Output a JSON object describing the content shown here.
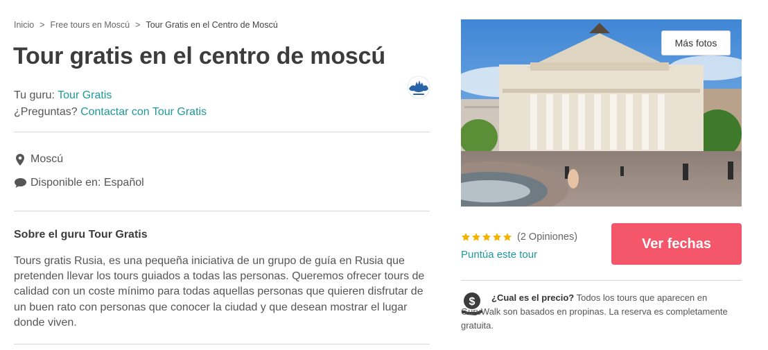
{
  "breadcrumb": {
    "items": [
      "Inicio",
      "Free tours en Moscú",
      "Tour Gratis en el Centro de Moscú"
    ],
    "separator": ">"
  },
  "tour": {
    "title": "Tour gratis en el centro de moscú",
    "guru_prefix": "Tu guru:",
    "guru_name": "Tour Gratis",
    "questions_prefix": "¿Preguntas?",
    "contact_link": "Contactar con Tour Gratis",
    "location": "Moscú",
    "languages": "Disponible en: Español",
    "photo_alt": "Teatro Bolshói"
  },
  "about": {
    "title": "Sobre el guru Tour Gratis",
    "text": "Tours gratis Rusia, es una pequeña iniciativa de un grupo de guía en Rusia que pretenden llevar los tours guiados a todas las personas. Queremos ofrecer tours de calidad con un coste mínimo para todas aquellas personas que quieren disfrutar de un buen rato con personas que conocer la ciudad y que desean mostrar el lugar donde viven."
  },
  "gallery": {
    "more_photos": "Más fotos"
  },
  "rating": {
    "stars": 5,
    "reviews": "(2 Opiniones)",
    "rate_link": "Puntúa este tour"
  },
  "cta": {
    "label": "Ver fechas"
  },
  "price": {
    "question": "¿Cual es el precio?",
    "answer": "Todos los tours que aparecen en GuruWalk son basados en propinas. La reserva es completamente gratuita."
  },
  "colors": {
    "accent": "#1d9a98",
    "cta": "#f5576a",
    "star": "#f5b301",
    "text": "#555555"
  },
  "icons": {
    "location": "map-pin-icon",
    "language": "speech-bubble-icon",
    "price": "money-hand-icon",
    "star": "star-icon"
  }
}
